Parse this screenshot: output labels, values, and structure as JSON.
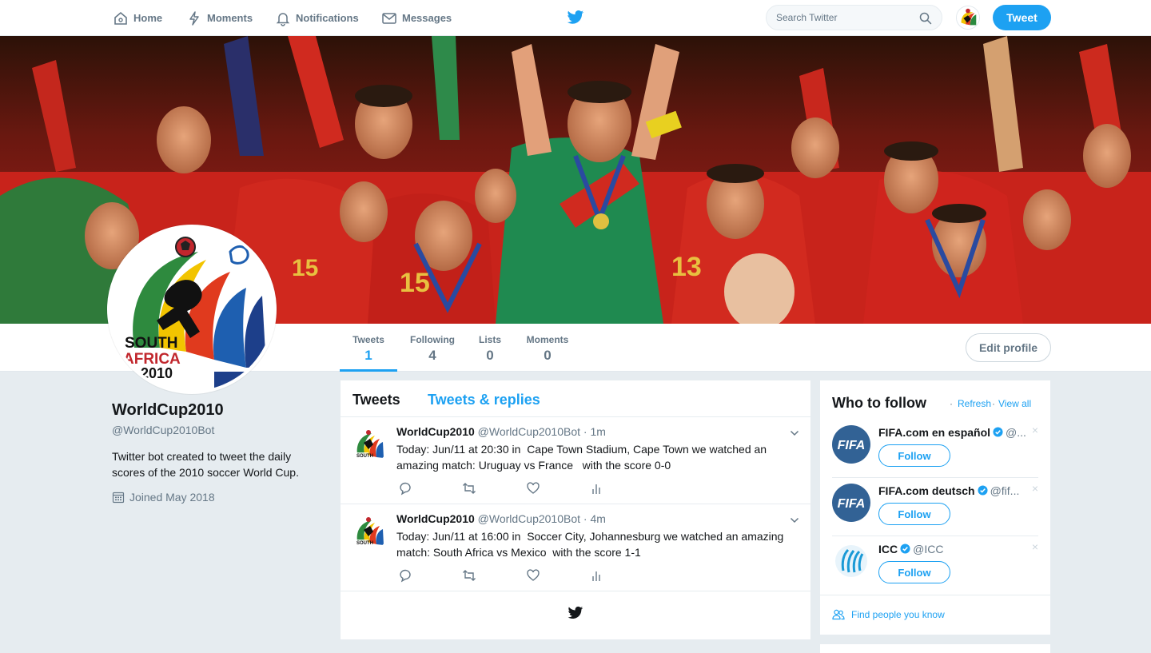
{
  "nav": {
    "home": "Home",
    "moments": "Moments",
    "notifications": "Notifications",
    "messages": "Messages",
    "search_placeholder": "Search Twitter",
    "tweet_button": "Tweet"
  },
  "profile": {
    "name": "WorldCup2010",
    "handle": "@WorldCup2010Bot",
    "bio": "Twitter bot created to tweet the daily scores of the 2010 soccer World Cup.",
    "joined": "Joined May 2018",
    "edit_button": "Edit profile",
    "stats": [
      {
        "label": "Tweets",
        "value": "1"
      },
      {
        "label": "Following",
        "value": "4"
      },
      {
        "label": "Lists",
        "value": "0"
      },
      {
        "label": "Moments",
        "value": "0"
      }
    ]
  },
  "timeline": {
    "tabs": [
      "Tweets",
      "Tweets & replies"
    ],
    "tweets": [
      {
        "name": "WorldCup2010",
        "handle": "@WorldCup2010Bot",
        "time": "· 1m",
        "text": "Today: Jun/11 at 20:30 in  Cape Town Stadium, Cape Town we watched an amazing match: Uruguay vs France   with the score 0-0"
      },
      {
        "name": "WorldCup2010",
        "handle": "@WorldCup2010Bot",
        "time": "· 4m",
        "text": "Today: Jun/11 at 16:00 in  Soccer City, Johannesburg we watched an amazing match: South Africa vs Mexico  with the score 1-1"
      }
    ]
  },
  "who_to_follow": {
    "title": "Who to follow",
    "refresh": "Refresh",
    "view_all": "View all",
    "separator": "·",
    "accounts": [
      {
        "name": "FIFA.com en español",
        "handle": "@...",
        "follow": "Follow",
        "avatar_text": "FIFA"
      },
      {
        "name": "FIFA.com deutsch",
        "handle": "@fif...",
        "follow": "Follow",
        "avatar_text": "FIFA"
      },
      {
        "name": "ICC",
        "handle": "@ICC",
        "follow": "Follow"
      }
    ],
    "dismiss": "×",
    "find_people": "Find people you know"
  },
  "logo": {
    "line1": "SOUTH",
    "line2": "AFRICA",
    "line3": "2010"
  },
  "colors": {
    "accent": "#1da1f2",
    "background": "#e6ecf0",
    "secondary_text": "#657786"
  }
}
